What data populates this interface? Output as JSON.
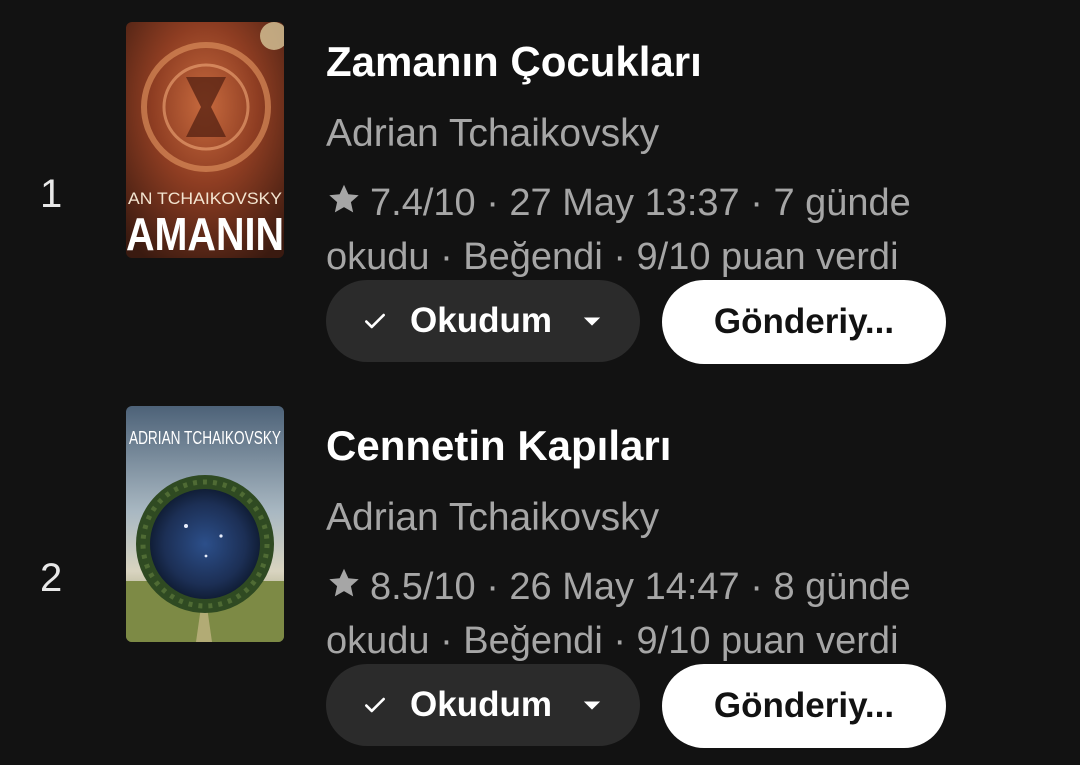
{
  "books": [
    {
      "rank": "1",
      "title": "Zamanın Çocukları",
      "author": "Adrian Tchaikovsky",
      "rating": "7.4/10",
      "meta_text": "7.4/10 · 27 May 13:37 · 7 günde okudu · Beğendi · 9/10 puan verdi",
      "status_label": "Okudum",
      "send_label": "Gönderiy...",
      "cover_text": "AN TCHAIKOVSKY",
      "cover_title": "AMANIN"
    },
    {
      "rank": "2",
      "title": "Cennetin Kapıları",
      "author": "Adrian Tchaikovsky",
      "rating": "8.5/10",
      "meta_text": "8.5/10 · 26 May 14:47 · 8 günde okudu · Beğendi · 9/10 puan verdi",
      "status_label": "Okudum",
      "send_label": "Gönderiy...",
      "cover_text": "ADRIAN TCHAIKOVSKY",
      "cover_title": ""
    }
  ],
  "icons": {
    "rating": "star-icon",
    "status": "check-icon",
    "dropdown": "caret-down-icon"
  },
  "colors": {
    "background": "#121212",
    "secondary_text": "#a6a6a6",
    "chip_background": "#2b2b2b",
    "send_button": "#ffffff"
  }
}
